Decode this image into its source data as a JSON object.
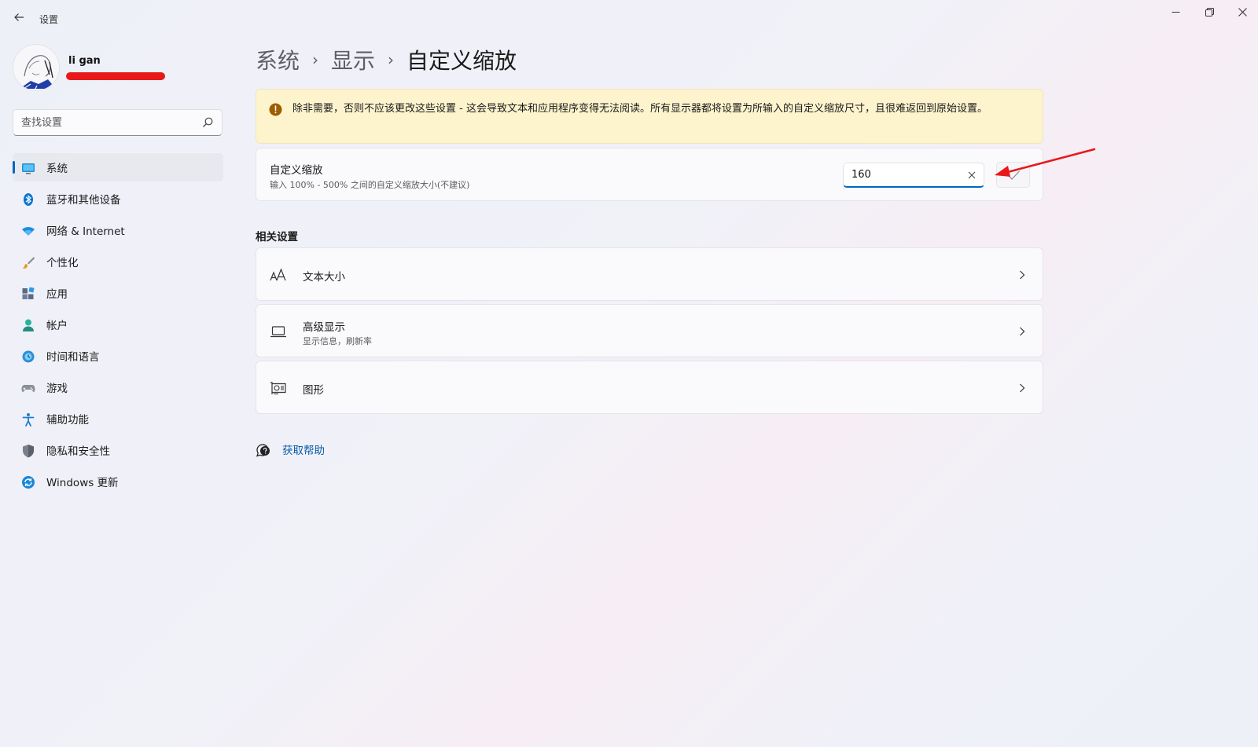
{
  "window": {
    "title": "设置"
  },
  "profile": {
    "name": "li gan"
  },
  "search": {
    "placeholder": "查找设置"
  },
  "nav": {
    "items": [
      {
        "label": "系统",
        "icon": "monitor-icon"
      },
      {
        "label": "蓝牙和其他设备",
        "icon": "bluetooth-icon"
      },
      {
        "label": "网络 & Internet",
        "icon": "wifi-icon"
      },
      {
        "label": "个性化",
        "icon": "brush-icon"
      },
      {
        "label": "应用",
        "icon": "apps-icon"
      },
      {
        "label": "帐户",
        "icon": "person-icon"
      },
      {
        "label": "时间和语言",
        "icon": "globe-clock-icon"
      },
      {
        "label": "游戏",
        "icon": "gamepad-icon"
      },
      {
        "label": "辅助功能",
        "icon": "accessibility-icon"
      },
      {
        "label": "隐私和安全性",
        "icon": "shield-icon"
      },
      {
        "label": "Windows 更新",
        "icon": "update-icon"
      }
    ],
    "active_index": 0
  },
  "breadcrumb": {
    "items": [
      "系统",
      "显示"
    ],
    "current": "自定义缩放",
    "separator": "›"
  },
  "warning": {
    "text": "除非需要，否则不应该更改这些设置 - 这会导致文本和应用程序变得无法阅读。所有显示器都将设置为所输入的自定义缩放尺寸，且很难返回到原始设置。"
  },
  "custom_scaling": {
    "title": "自定义缩放",
    "description": "输入 100% - 500% 之间的自定义缩放大小(不建议)",
    "value": "160"
  },
  "related": {
    "title": "相关设置",
    "items": [
      {
        "title": "文本大小",
        "subtitle": "",
        "icon": "text-size-icon"
      },
      {
        "title": "高级显示",
        "subtitle": "显示信息，刷新率",
        "icon": "laptop-icon"
      },
      {
        "title": "图形",
        "subtitle": "",
        "icon": "graphics-card-icon"
      }
    ]
  },
  "help": {
    "label": "获取帮助"
  },
  "colors": {
    "accent": "#0067c0",
    "warning_bg": "#fdf4ce",
    "warning_icon": "#9d5d00",
    "annotation": "#e8191b"
  }
}
